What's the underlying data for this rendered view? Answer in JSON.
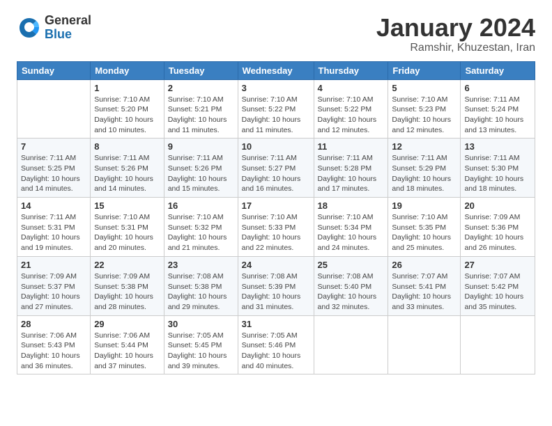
{
  "logo": {
    "general": "General",
    "blue": "Blue"
  },
  "header": {
    "month": "January 2024",
    "location": "Ramshir, Khuzestan, Iran"
  },
  "days_of_week": [
    "Sunday",
    "Monday",
    "Tuesday",
    "Wednesday",
    "Thursday",
    "Friday",
    "Saturday"
  ],
  "weeks": [
    [
      {
        "day": "",
        "info": ""
      },
      {
        "day": "1",
        "info": "Sunrise: 7:10 AM\nSunset: 5:20 PM\nDaylight: 10 hours\nand 10 minutes."
      },
      {
        "day": "2",
        "info": "Sunrise: 7:10 AM\nSunset: 5:21 PM\nDaylight: 10 hours\nand 11 minutes."
      },
      {
        "day": "3",
        "info": "Sunrise: 7:10 AM\nSunset: 5:22 PM\nDaylight: 10 hours\nand 11 minutes."
      },
      {
        "day": "4",
        "info": "Sunrise: 7:10 AM\nSunset: 5:22 PM\nDaylight: 10 hours\nand 12 minutes."
      },
      {
        "day": "5",
        "info": "Sunrise: 7:10 AM\nSunset: 5:23 PM\nDaylight: 10 hours\nand 12 minutes."
      },
      {
        "day": "6",
        "info": "Sunrise: 7:11 AM\nSunset: 5:24 PM\nDaylight: 10 hours\nand 13 minutes."
      }
    ],
    [
      {
        "day": "7",
        "info": "Sunrise: 7:11 AM\nSunset: 5:25 PM\nDaylight: 10 hours\nand 14 minutes."
      },
      {
        "day": "8",
        "info": "Sunrise: 7:11 AM\nSunset: 5:26 PM\nDaylight: 10 hours\nand 14 minutes."
      },
      {
        "day": "9",
        "info": "Sunrise: 7:11 AM\nSunset: 5:26 PM\nDaylight: 10 hours\nand 15 minutes."
      },
      {
        "day": "10",
        "info": "Sunrise: 7:11 AM\nSunset: 5:27 PM\nDaylight: 10 hours\nand 16 minutes."
      },
      {
        "day": "11",
        "info": "Sunrise: 7:11 AM\nSunset: 5:28 PM\nDaylight: 10 hours\nand 17 minutes."
      },
      {
        "day": "12",
        "info": "Sunrise: 7:11 AM\nSunset: 5:29 PM\nDaylight: 10 hours\nand 18 minutes."
      },
      {
        "day": "13",
        "info": "Sunrise: 7:11 AM\nSunset: 5:30 PM\nDaylight: 10 hours\nand 18 minutes."
      }
    ],
    [
      {
        "day": "14",
        "info": "Sunrise: 7:11 AM\nSunset: 5:31 PM\nDaylight: 10 hours\nand 19 minutes."
      },
      {
        "day": "15",
        "info": "Sunrise: 7:10 AM\nSunset: 5:31 PM\nDaylight: 10 hours\nand 20 minutes."
      },
      {
        "day": "16",
        "info": "Sunrise: 7:10 AM\nSunset: 5:32 PM\nDaylight: 10 hours\nand 21 minutes."
      },
      {
        "day": "17",
        "info": "Sunrise: 7:10 AM\nSunset: 5:33 PM\nDaylight: 10 hours\nand 22 minutes."
      },
      {
        "day": "18",
        "info": "Sunrise: 7:10 AM\nSunset: 5:34 PM\nDaylight: 10 hours\nand 24 minutes."
      },
      {
        "day": "19",
        "info": "Sunrise: 7:10 AM\nSunset: 5:35 PM\nDaylight: 10 hours\nand 25 minutes."
      },
      {
        "day": "20",
        "info": "Sunrise: 7:09 AM\nSunset: 5:36 PM\nDaylight: 10 hours\nand 26 minutes."
      }
    ],
    [
      {
        "day": "21",
        "info": "Sunrise: 7:09 AM\nSunset: 5:37 PM\nDaylight: 10 hours\nand 27 minutes."
      },
      {
        "day": "22",
        "info": "Sunrise: 7:09 AM\nSunset: 5:38 PM\nDaylight: 10 hours\nand 28 minutes."
      },
      {
        "day": "23",
        "info": "Sunrise: 7:08 AM\nSunset: 5:38 PM\nDaylight: 10 hours\nand 29 minutes."
      },
      {
        "day": "24",
        "info": "Sunrise: 7:08 AM\nSunset: 5:39 PM\nDaylight: 10 hours\nand 31 minutes."
      },
      {
        "day": "25",
        "info": "Sunrise: 7:08 AM\nSunset: 5:40 PM\nDaylight: 10 hours\nand 32 minutes."
      },
      {
        "day": "26",
        "info": "Sunrise: 7:07 AM\nSunset: 5:41 PM\nDaylight: 10 hours\nand 33 minutes."
      },
      {
        "day": "27",
        "info": "Sunrise: 7:07 AM\nSunset: 5:42 PM\nDaylight: 10 hours\nand 35 minutes."
      }
    ],
    [
      {
        "day": "28",
        "info": "Sunrise: 7:06 AM\nSunset: 5:43 PM\nDaylight: 10 hours\nand 36 minutes."
      },
      {
        "day": "29",
        "info": "Sunrise: 7:06 AM\nSunset: 5:44 PM\nDaylight: 10 hours\nand 37 minutes."
      },
      {
        "day": "30",
        "info": "Sunrise: 7:05 AM\nSunset: 5:45 PM\nDaylight: 10 hours\nand 39 minutes."
      },
      {
        "day": "31",
        "info": "Sunrise: 7:05 AM\nSunset: 5:46 PM\nDaylight: 10 hours\nand 40 minutes."
      },
      {
        "day": "",
        "info": ""
      },
      {
        "day": "",
        "info": ""
      },
      {
        "day": "",
        "info": ""
      }
    ]
  ]
}
